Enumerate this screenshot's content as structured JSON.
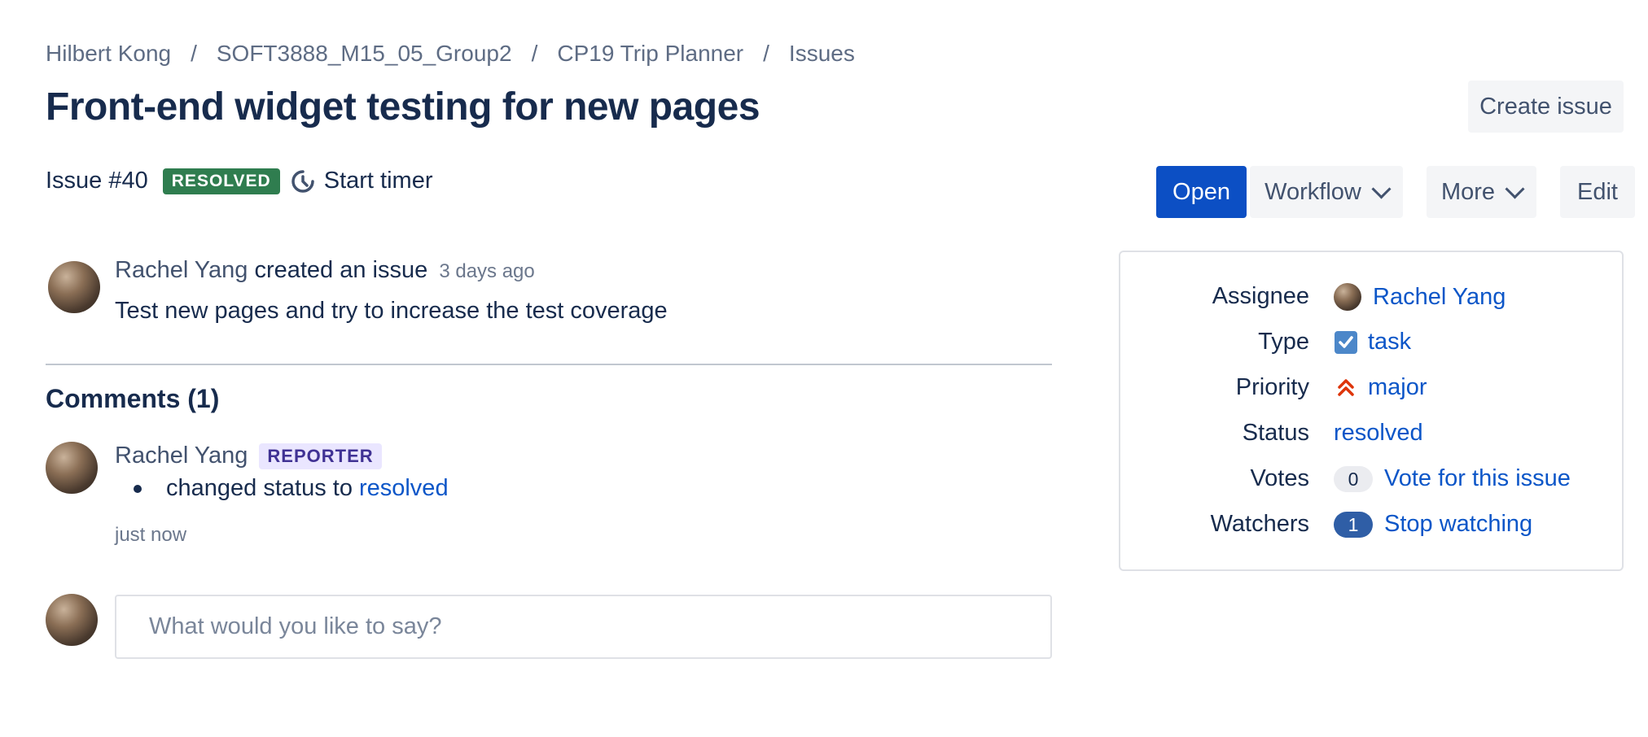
{
  "breadcrumb": {
    "items": [
      "Hilbert Kong",
      "SOFT3888_M15_05_Group2",
      "CP19 Trip Planner",
      "Issues"
    ],
    "separator": "/"
  },
  "issue": {
    "title": "Front-end widget testing for new pages",
    "number": "Issue #40",
    "status_badge": "RESOLVED",
    "timer_label": "Start timer"
  },
  "actions": {
    "create_issue": "Create issue",
    "open": "Open",
    "workflow": "Workflow",
    "more": "More",
    "edit": "Edit"
  },
  "activity": {
    "author": "Rachel Yang",
    "action": "created an issue",
    "time": "3 days ago",
    "description": "Test new pages and try to increase the test coverage"
  },
  "comments": {
    "title": "Comments (1)",
    "items": [
      {
        "author": "Rachel Yang",
        "role_badge": "REPORTER",
        "change_prefix": "changed status to",
        "change_value": "resolved",
        "time": "just now"
      }
    ],
    "input_placeholder": "What would you like to say?"
  },
  "details": {
    "assignee_label": "Assignee",
    "assignee": "Rachel Yang",
    "type_label": "Type",
    "type": "task",
    "priority_label": "Priority",
    "priority": "major",
    "status_label": "Status",
    "status": "resolved",
    "votes_label": "Votes",
    "votes_count": "0",
    "vote_action": "Vote for this issue",
    "watchers_label": "Watchers",
    "watchers_count": "1",
    "watch_action": "Stop watching"
  },
  "colors": {
    "primary": "#0c4fc4",
    "resolved_badge": "#2f7d4f",
    "link": "#0c56c8",
    "reporter_badge_bg": "#eae6ff",
    "priority_major": "#de350b",
    "type_task": "#4c87c9"
  },
  "icons": {
    "timer": "timer-icon",
    "type": "checkbox-task-icon",
    "priority": "double-chevron-up-icon",
    "dropdown": "chevron-down-icon"
  }
}
